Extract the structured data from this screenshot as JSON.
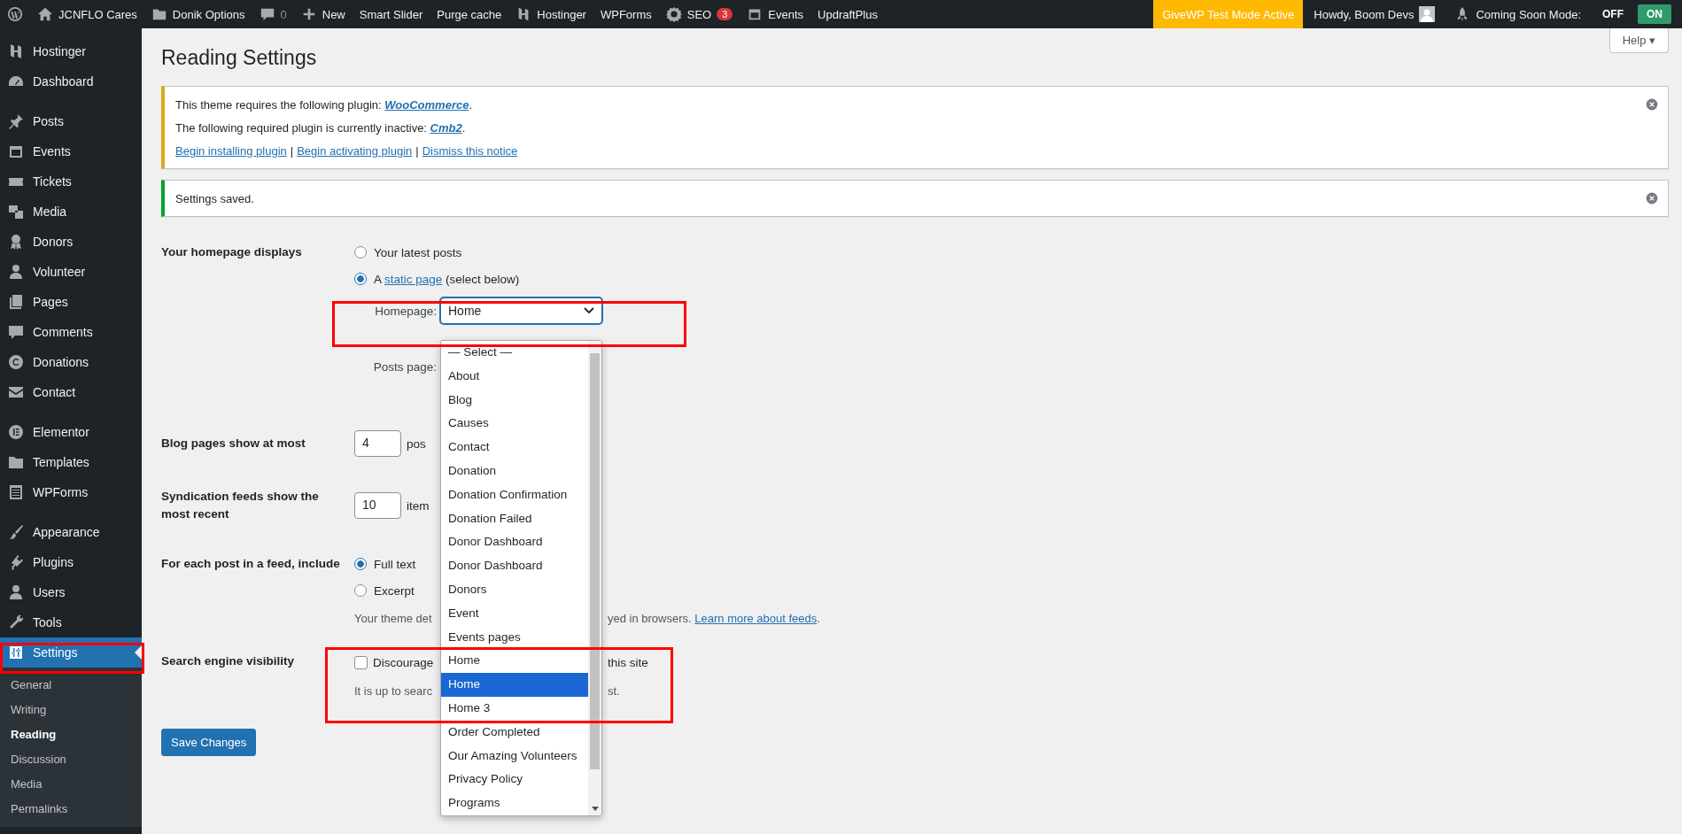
{
  "admin_bar": {
    "left": [
      {
        "kind": "wp"
      },
      {
        "kind": "site",
        "label": "JCNFLO Cares"
      },
      {
        "kind": "folder",
        "label": "Donik Options"
      },
      {
        "kind": "comments",
        "label": "0"
      },
      {
        "kind": "new",
        "label": "New"
      },
      {
        "kind": "text",
        "label": "Smart Slider"
      },
      {
        "kind": "text",
        "label": "Purge cache"
      },
      {
        "kind": "hostinger",
        "label": "Hostinger"
      },
      {
        "kind": "text",
        "label": "WPForms"
      },
      {
        "kind": "seo",
        "label": "SEO",
        "badge": "3"
      },
      {
        "kind": "events",
        "label": "Events"
      },
      {
        "kind": "text",
        "label": "UpdraftPlus"
      }
    ],
    "test_mode": "GiveWP Test Mode Active",
    "howdy": "Howdy, Boom Devs",
    "coming_soon": {
      "label": "Coming Soon Mode:",
      "options": [
        {
          "label": "OFF",
          "selected": false
        },
        {
          "label": "ON",
          "selected": true
        }
      ]
    }
  },
  "sidebar": {
    "groups": [
      [
        {
          "kind": "hostinger",
          "label": "Hostinger",
          "selected": false
        },
        {
          "kind": "dashboard",
          "label": "Dashboard",
          "selected": false
        }
      ],
      [
        {
          "kind": "posts",
          "label": "Posts",
          "selected": false
        },
        {
          "kind": "events",
          "label": "Events",
          "selected": false
        },
        {
          "kind": "tickets",
          "label": "Tickets",
          "selected": false
        },
        {
          "kind": "media",
          "label": "Media",
          "selected": false
        },
        {
          "kind": "donors",
          "label": "Donors",
          "selected": false
        },
        {
          "kind": "volunteer",
          "label": "Volunteer",
          "selected": false
        },
        {
          "kind": "pages",
          "label": "Pages",
          "selected": false
        },
        {
          "kind": "comments",
          "label": "Comments",
          "selected": false
        },
        {
          "kind": "donations",
          "label": "Donations",
          "selected": false
        },
        {
          "kind": "contact",
          "label": "Contact",
          "selected": false
        }
      ],
      [
        {
          "kind": "elementor",
          "label": "Elementor",
          "selected": false
        },
        {
          "kind": "templates",
          "label": "Templates",
          "selected": false
        },
        {
          "kind": "wpforms",
          "label": "WPForms",
          "selected": false
        }
      ],
      [
        {
          "kind": "appearance",
          "label": "Appearance",
          "selected": false
        },
        {
          "kind": "plugins",
          "label": "Plugins",
          "selected": false
        },
        {
          "kind": "users",
          "label": "Users",
          "selected": false
        },
        {
          "kind": "tools",
          "label": "Tools",
          "selected": false
        },
        {
          "kind": "settings",
          "label": "Settings",
          "selected": true
        }
      ]
    ],
    "submenu": [
      {
        "label": "General",
        "selected": false
      },
      {
        "label": "Writing",
        "selected": false
      },
      {
        "label": "Reading",
        "selected": true
      },
      {
        "label": "Discussion",
        "selected": false
      },
      {
        "label": "Media",
        "selected": false
      },
      {
        "label": "Permalinks",
        "selected": false
      }
    ]
  },
  "page": {
    "title": "Reading Settings",
    "help": "Help ▾"
  },
  "notices": [
    {
      "kind": "warning",
      "lines": [
        {
          "text": "This theme requires the following plugin:",
          "link": "WooCommerce",
          "suffix": "."
        },
        {
          "text": "The following required plugin is currently inactive:",
          "link": "Cmb2",
          "suffix": "."
        }
      ],
      "actions": [
        "Begin installing plugin",
        "Begin activating plugin",
        "Dismiss this notice"
      ],
      "separator": "|"
    },
    {
      "kind": "success",
      "lines": [
        {
          "text": "Settings saved."
        }
      ]
    }
  ],
  "form": {
    "homepage_displays": {
      "label": "Your homepage displays",
      "options": [
        {
          "label": "Your latest posts",
          "selected": false
        },
        {
          "label": "A",
          "link": "static page",
          "suffix": "(select below)",
          "selected": true
        }
      ]
    },
    "homepage": {
      "label": "Homepage:",
      "value": "Home"
    },
    "posts_page": {
      "label": "Posts page:"
    },
    "blog_pages": {
      "label": "Blog pages show at most",
      "value": "4",
      "unit": "pos"
    },
    "syndication": {
      "label": "Syndication feeds show the most recent",
      "value": "10",
      "unit": "item"
    },
    "feed_include": {
      "label": "For each post in a feed, include",
      "options": [
        {
          "label": "Full text",
          "selected": true
        },
        {
          "label": "Excerpt",
          "selected": false
        }
      ],
      "note_start": "Your theme det",
      "note_end": "yed in browsers.",
      "link": "Learn more about feeds",
      "link_suffix": "."
    },
    "search_visibility": {
      "label": "Search engine visibility",
      "checked": false,
      "check_start": "Discourage",
      "check_end": "this site",
      "note_start": "It is up to searc",
      "note_end": "st."
    },
    "save": "Save Changes"
  },
  "dropdown": {
    "options": [
      {
        "label": "— Select —",
        "selected": false
      },
      {
        "label": "About",
        "selected": false
      },
      {
        "label": "Blog",
        "selected": false
      },
      {
        "label": "Causes",
        "selected": false
      },
      {
        "label": "Contact",
        "selected": false
      },
      {
        "label": "Donation",
        "selected": false
      },
      {
        "label": "Donation Confirmation",
        "selected": false
      },
      {
        "label": "Donation Failed",
        "selected": false
      },
      {
        "label": "Donor Dashboard",
        "selected": false
      },
      {
        "label": "Donor Dashboard",
        "selected": false
      },
      {
        "label": "Donors",
        "selected": false
      },
      {
        "label": "Event",
        "selected": false
      },
      {
        "label": "Events pages",
        "selected": false
      },
      {
        "label": "Home",
        "selected": false
      },
      {
        "label": "Home",
        "selected": true
      },
      {
        "label": "Home 3",
        "selected": false
      },
      {
        "label": "Order Completed",
        "selected": false
      },
      {
        "label": "Our Amazing Volunteers",
        "selected": false
      },
      {
        "label": "Privacy Policy",
        "selected": false
      },
      {
        "label": "Programs",
        "selected": false
      }
    ]
  }
}
